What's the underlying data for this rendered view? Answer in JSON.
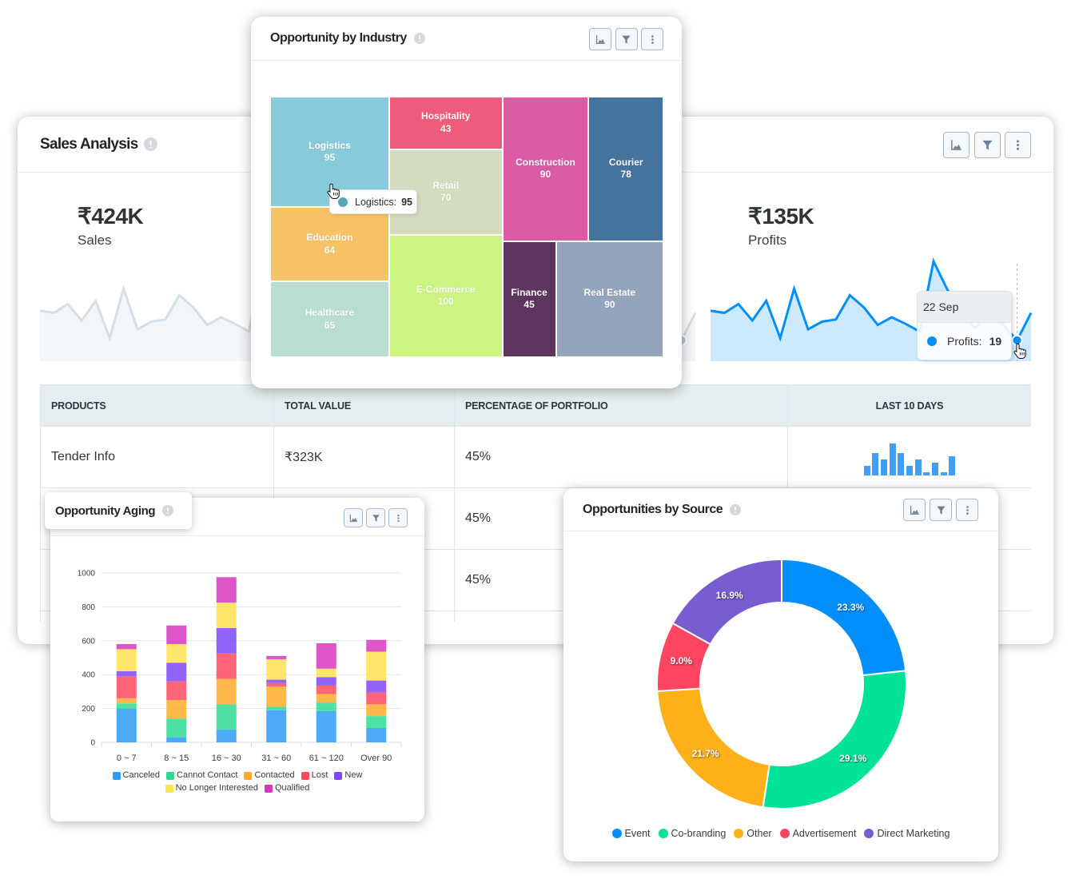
{
  "sales_analysis": {
    "title": "Sales Analysis",
    "kpis": [
      {
        "value": "₹424K",
        "label": "Sales"
      },
      {
        "value": "₹135K",
        "label": "Profits"
      }
    ],
    "table": {
      "headers": [
        "PRODUCTS",
        "TOTAL VALUE",
        "PERCENTAGE OF PORTFOLIO",
        "LAST 10 DAYS"
      ],
      "rows": [
        {
          "product": "Tender Info",
          "total_value": "₹323K",
          "percentage": "45%"
        },
        {
          "percentage": "45%"
        },
        {
          "percentage": "45%"
        }
      ]
    }
  },
  "widgets": {
    "industry": {
      "title": "Opportunity by Industry",
      "tooltip": {
        "label": "Logistics:",
        "value": "95",
        "color": "#5AA5B8"
      }
    },
    "aging": {
      "title": "Opportunity Aging"
    },
    "source": {
      "title": "Opportunities by Source"
    }
  },
  "icons": {
    "info": "info-icon",
    "toolbar": [
      {
        "button": "chart-type-button",
        "icon": "area-chart-icon"
      },
      {
        "button": "filter-button",
        "icon": "filter-icon"
      },
      {
        "button": "more-options-button",
        "icon": "more-vertical-icon"
      }
    ],
    "cursor": "pointer-hand-icon"
  },
  "colors": {
    "table_header_bg": "#E5EDF0",
    "button_border": "#A8B9C7",
    "icon": "#6D8395",
    "info_icon": "#D3D9DE"
  },
  "chart_data": [
    {
      "type": "treemap",
      "title": "Opportunity by Industry",
      "data": [
        {
          "name": "Logistics",
          "value": 95,
          "color": "#87CADA"
        },
        {
          "name": "Hospitality",
          "value": 43,
          "color": "#EF5B7B"
        },
        {
          "name": "Retail",
          "value": 70,
          "color": "#D4DCBF"
        },
        {
          "name": "Education",
          "value": 64,
          "color": "#F6C266"
        },
        {
          "name": "Healthcare",
          "value": 65,
          "color": "#B9DED1"
        },
        {
          "name": "E-Commerce",
          "value": 100,
          "color": "#CBF580"
        },
        {
          "name": "Construction",
          "value": 90,
          "color": "#DB5BA5"
        },
        {
          "name": "Courier",
          "value": 78,
          "color": "#44739E"
        },
        {
          "name": "Finance",
          "value": 45,
          "color": "#5E355E"
        },
        {
          "name": "Real Estate",
          "value": 90,
          "color": "#94A4BD"
        }
      ],
      "highlighted": "Logistics"
    },
    {
      "type": "bar",
      "stacked": true,
      "title": "Opportunity Aging",
      "xlabel": "",
      "ylabel": "",
      "categories": [
        "0 ~ 7",
        "8 ~ 15",
        "16 ~ 30",
        "31 ~ 60",
        "61 ~ 120",
        "Over 90"
      ],
      "series": [
        {
          "name": "Canceled",
          "color": "#2E9BF7",
          "values": [
            200,
            30,
            75,
            190,
            185,
            85
          ]
        },
        {
          "name": "Cannot Contact",
          "color": "#2EDC94",
          "values": [
            30,
            110,
            150,
            20,
            50,
            70
          ]
        },
        {
          "name": "Contacted",
          "color": "#FFAB2A",
          "values": [
            30,
            110,
            150,
            120,
            50,
            70
          ]
        },
        {
          "name": "Lost",
          "color": "#FF4A5F",
          "values": [
            130,
            110,
            150,
            20,
            50,
            70
          ]
        },
        {
          "name": "New",
          "color": "#7E48F8",
          "values": [
            30,
            110,
            150,
            20,
            50,
            70
          ]
        },
        {
          "name": "No Longer Interested",
          "color": "#FFE250",
          "values": [
            130,
            110,
            150,
            120,
            50,
            170
          ]
        },
        {
          "name": "Qualified",
          "color": "#D837C0",
          "values": [
            30,
            110,
            150,
            20,
            150,
            70
          ]
        }
      ],
      "ylim": [
        0,
        1000
      ],
      "yticks": [
        0,
        200,
        400,
        600,
        800,
        1000
      ],
      "grid": true,
      "legend": "bottom"
    },
    {
      "type": "pie",
      "donut": true,
      "title": "Opportunities by Source",
      "labels": [
        "Event",
        "Co-branding",
        "Other",
        "Advertisement",
        "Direct Marketing"
      ],
      "values": [
        23.3,
        29.1,
        21.7,
        9.0,
        16.9
      ],
      "value_labels": [
        "23.3%",
        "29.1%",
        "21.7%",
        "9.0%",
        "16.9%"
      ],
      "colors": [
        "#008FFB",
        "#00E396",
        "#FEB019",
        "#FF4560",
        "#775DD0"
      ],
      "legend": "bottom"
    },
    {
      "type": "area",
      "title": "Sales",
      "values": [
        46,
        44,
        52,
        37,
        55,
        21,
        66,
        29,
        36,
        38,
        60,
        49,
        33,
        40,
        34,
        27,
        91,
        65,
        45,
        30,
        45,
        33,
        19,
        44
      ],
      "color": "#D5DFE7",
      "hover_index": 22
    },
    {
      "type": "area",
      "values": [
        46,
        44,
        52,
        37,
        55,
        21,
        66,
        29,
        36,
        38,
        60,
        49,
        33,
        40,
        34,
        27,
        91,
        65,
        45,
        30,
        45,
        33,
        19,
        44
      ],
      "color": "#D5DFE7",
      "hover_index": 22
    },
    {
      "type": "area",
      "title": "Profits",
      "values": [
        46,
        44,
        52,
        37,
        55,
        21,
        66,
        29,
        36,
        38,
        60,
        49,
        33,
        40,
        34,
        27,
        91,
        65,
        45,
        30,
        45,
        33,
        19,
        44
      ],
      "color": "#008FFB",
      "hover_index": 22,
      "crosshair": true,
      "tooltip": {
        "date": "22 Sep",
        "label": "Profits:",
        "value": "19"
      }
    },
    {
      "type": "bar",
      "title": "LAST 10 DAYS",
      "category": "Tender Info",
      "values": [
        3,
        7,
        5,
        10,
        7,
        3,
        5,
        1,
        4,
        1,
        6
      ],
      "color": "#419EF4"
    }
  ]
}
